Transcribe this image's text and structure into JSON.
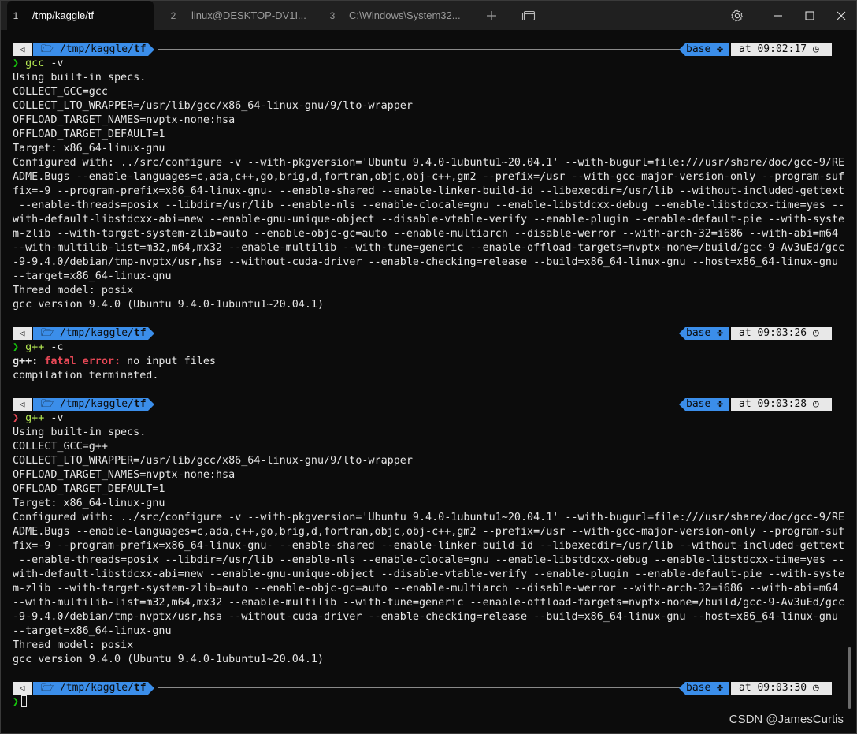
{
  "tabs": [
    {
      "num": "1",
      "title": "/tmp/kaggle/tf"
    },
    {
      "num": "2",
      "title": "linux@DESKTOP-DV1I..."
    },
    {
      "num": "3",
      "title": "C:\\Windows\\System32..."
    }
  ],
  "prompts": [
    {
      "os_icon": "◁",
      "path_prefix": "/tmp/kaggle/",
      "path_last": "tf",
      "env": "base",
      "time": "at 09:02:17"
    },
    {
      "os_icon": "◁",
      "path_prefix": "/tmp/kaggle/",
      "path_last": "tf",
      "env": "base",
      "time": "at 09:03:26"
    },
    {
      "os_icon": "◁",
      "path_prefix": "/tmp/kaggle/",
      "path_last": "tf",
      "env": "base",
      "time": "at 09:03:28"
    },
    {
      "os_icon": "◁",
      "path_prefix": "/tmp/kaggle/",
      "path_last": "tf",
      "env": "base",
      "time": "at 09:03:30"
    }
  ],
  "commands": [
    {
      "chevron": "❯",
      "name": "gcc",
      "args": " -v"
    },
    {
      "chevron": "❯",
      "name": "g++",
      "args": " -c"
    },
    {
      "chevron": "❯",
      "name": "g++",
      "args": " -v"
    },
    {
      "chevron": "❯"
    }
  ],
  "out1": [
    "Using built-in specs.",
    "COLLECT_GCC=gcc",
    "COLLECT_LTO_WRAPPER=/usr/lib/gcc/x86_64-linux-gnu/9/lto-wrapper",
    "OFFLOAD_TARGET_NAMES=nvptx-none:hsa",
    "OFFLOAD_TARGET_DEFAULT=1",
    "Target: x86_64-linux-gnu",
    "Configured with: ../src/configure -v --with-pkgversion='Ubuntu 9.4.0-1ubuntu1~20.04.1' --with-bugurl=file:///usr/share/doc/gcc-9/RE",
    "ADME.Bugs --enable-languages=c,ada,c++,go,brig,d,fortran,objc,obj-c++,gm2 --prefix=/usr --with-gcc-major-version-only --program-suf",
    "fix=-9 --program-prefix=x86_64-linux-gnu- --enable-shared --enable-linker-build-id --libexecdir=/usr/lib --without-included-gettext",
    " --enable-threads=posix --libdir=/usr/lib --enable-nls --enable-clocale=gnu --enable-libstdcxx-debug --enable-libstdcxx-time=yes --",
    "with-default-libstdcxx-abi=new --enable-gnu-unique-object --disable-vtable-verify --enable-plugin --enable-default-pie --with-syste",
    "m-zlib --with-target-system-zlib=auto --enable-objc-gc=auto --enable-multiarch --disable-werror --with-arch-32=i686 --with-abi=m64",
    "--with-multilib-list=m32,m64,mx32 --enable-multilib --with-tune=generic --enable-offload-targets=nvptx-none=/build/gcc-9-Av3uEd/gcc",
    "-9-9.4.0/debian/tmp-nvptx/usr,hsa --without-cuda-driver --enable-checking=release --build=x86_64-linux-gnu --host=x86_64-linux-gnu",
    "--target=x86_64-linux-gnu",
    "Thread model: posix",
    "gcc version 9.4.0 (Ubuntu 9.4.0-1ubuntu1~20.04.1)"
  ],
  "out2": {
    "prog": "g++:",
    "err": "fatal error:",
    "msg": " no input files",
    "line2": "compilation terminated."
  },
  "out3": [
    "Using built-in specs.",
    "COLLECT_GCC=g++",
    "COLLECT_LTO_WRAPPER=/usr/lib/gcc/x86_64-linux-gnu/9/lto-wrapper",
    "OFFLOAD_TARGET_NAMES=nvptx-none:hsa",
    "OFFLOAD_TARGET_DEFAULT=1",
    "Target: x86_64-linux-gnu",
    "Configured with: ../src/configure -v --with-pkgversion='Ubuntu 9.4.0-1ubuntu1~20.04.1' --with-bugurl=file:///usr/share/doc/gcc-9/RE",
    "ADME.Bugs --enable-languages=c,ada,c++,go,brig,d,fortran,objc,obj-c++,gm2 --prefix=/usr --with-gcc-major-version-only --program-suf",
    "fix=-9 --program-prefix=x86_64-linux-gnu- --enable-shared --enable-linker-build-id --libexecdir=/usr/lib --without-included-gettext",
    " --enable-threads=posix --libdir=/usr/lib --enable-nls --enable-clocale=gnu --enable-libstdcxx-debug --enable-libstdcxx-time=yes --",
    "with-default-libstdcxx-abi=new --enable-gnu-unique-object --disable-vtable-verify --enable-plugin --enable-default-pie --with-syste",
    "m-zlib --with-target-system-zlib=auto --enable-objc-gc=auto --enable-multiarch --disable-werror --with-arch-32=i686 --with-abi=m64",
    "--with-multilib-list=m32,m64,mx32 --enable-multilib --with-tune=generic --enable-offload-targets=nvptx-none=/build/gcc-9-Av3uEd/gcc",
    "-9-9.4.0/debian/tmp-nvptx/usr,hsa --without-cuda-driver --enable-checking=release --build=x86_64-linux-gnu --host=x86_64-linux-gnu",
    "--target=x86_64-linux-gnu",
    "Thread model: posix",
    "gcc version 9.4.0 (Ubuntu 9.4.0-1ubuntu1~20.04.1)"
  ],
  "watermark": "CSDN @JamesCurtis",
  "colors": {
    "accent": "#3b8eea",
    "ok": "#16c60c",
    "error": "#e74856",
    "command": "#b5e853"
  }
}
